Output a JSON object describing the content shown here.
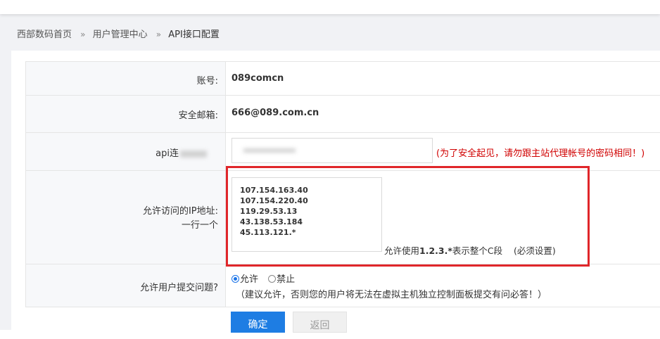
{
  "breadcrumb": {
    "items": [
      "西部数码首页",
      "用户管理中心",
      "API接口配置"
    ],
    "separator": "»"
  },
  "form": {
    "account": {
      "label": "账号:",
      "value": "089comcn"
    },
    "email": {
      "label": "安全邮箱:",
      "value": "666@089.com.cn"
    },
    "api_password": {
      "label": "api连",
      "hint": "(为了安全起见，请勿跟主站代理帐号的密码相同！)"
    },
    "ip_whitelist": {
      "label_line1": "允许访问的IP地址:",
      "label_line2": "一行一个",
      "ips": [
        "107.154.163.40",
        "107.154.220.40",
        "119.29.53.13",
        "43.138.53.184",
        "45.113.121.*"
      ],
      "hint_prefix": "允许使用",
      "hint_example": "1.2.3.*",
      "hint_suffix": "表示整个C段",
      "hint_required": "(必须设置)"
    },
    "allow_questions": {
      "label": "允许用户提交问题?",
      "options": [
        "允许",
        "禁止"
      ],
      "selected": "允许",
      "note": "（建议允许，否则您的用户将无法在虚拟主机独立控制面板提交有问必答！）"
    }
  },
  "buttons": {
    "ok": "确定",
    "back": "返回"
  },
  "colors": {
    "primary": "#1e7de3",
    "warning": "#d00000",
    "highlight": "#e0262a"
  }
}
